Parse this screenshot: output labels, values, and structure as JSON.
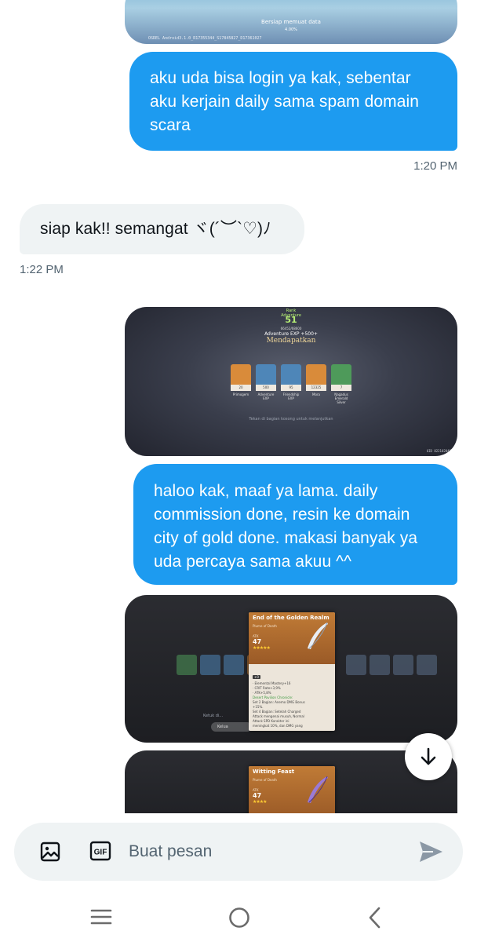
{
  "images": {
    "top": {
      "loading_text": "Bersiap memuat data",
      "loading_percent": "4.00%",
      "uid_text": "OSREL Android3.1.0_R17355344_S17845827_D17361027"
    },
    "reward": {
      "rank_label": "Rank",
      "rank_label2": "Adventure",
      "rank": "51",
      "xp_small": "66452/68600",
      "xp_line": "Adventure EXP +500+",
      "title": "Mendapatkan",
      "items": [
        {
          "count": "20",
          "name": "Primogem",
          "color": "#d98b3a"
        },
        {
          "count": "500",
          "name": "Adventure EXP",
          "color": "#4e86b8"
        },
        {
          "count": "95",
          "name": "Friendship EXP",
          "color": "#4e86b8"
        },
        {
          "count": "12325",
          "name": "Mora",
          "color": "#d98b3a"
        },
        {
          "count": "7",
          "name": "Nagadus Emerald Silver",
          "color": "#4e9a5a"
        }
      ],
      "hint": "Tekan di bagian kosong untuk melanjutkan",
      "uid": "UID 822102049"
    },
    "artifact": {
      "name": "End of the Golden Realm",
      "type": "Plume of Death",
      "stat_name": "ATK",
      "stat_value": "47",
      "stars": "★★★★★",
      "level": "+0",
      "substats": [
        "· Elemental Mastery+16",
        "· CRIT Rate+3,9%",
        "· ATK+5,8%"
      ],
      "set_name": "Desert Pavilion Chronicle:",
      "set_lines": [
        "Set 2 Bagian: Anemo DMG Bonus",
        "+15%.",
        "Set 4 Bagian: Setelah Charged",
        "Attack mengenai musuh, Normal",
        "Attack SPD Karakter ini",
        "meningkat 10%, dan DMG yang"
      ],
      "keluar": "Kelua",
      "ket": "Ketuk di..."
    },
    "witting": {
      "name": "Witting Feast",
      "type": "Plume of Death",
      "stat_name": "ATK",
      "stat_value": "47",
      "stars": "★★★★"
    }
  },
  "messages": {
    "m1": "aku uda bisa login ya kak, sebentar aku kerjain daily sama spam domain scara",
    "t1": "1:20 PM",
    "m2": "siap kak!! semangat ヾ(´︶`♡)ﾉ",
    "t2": "1:22 PM",
    "m3": "haloo kak, maaf ya lama. daily commission done, resin ke domain city of gold done. makasi banyak ya uda percaya sama akuu ^^"
  },
  "composer": {
    "placeholder": "Buat pesan",
    "gif_label": "GIF"
  },
  "colors": {
    "outgoing_bubble": "#1d9bf0",
    "incoming_bubble": "#eff3f4",
    "timestamp": "#536471"
  }
}
